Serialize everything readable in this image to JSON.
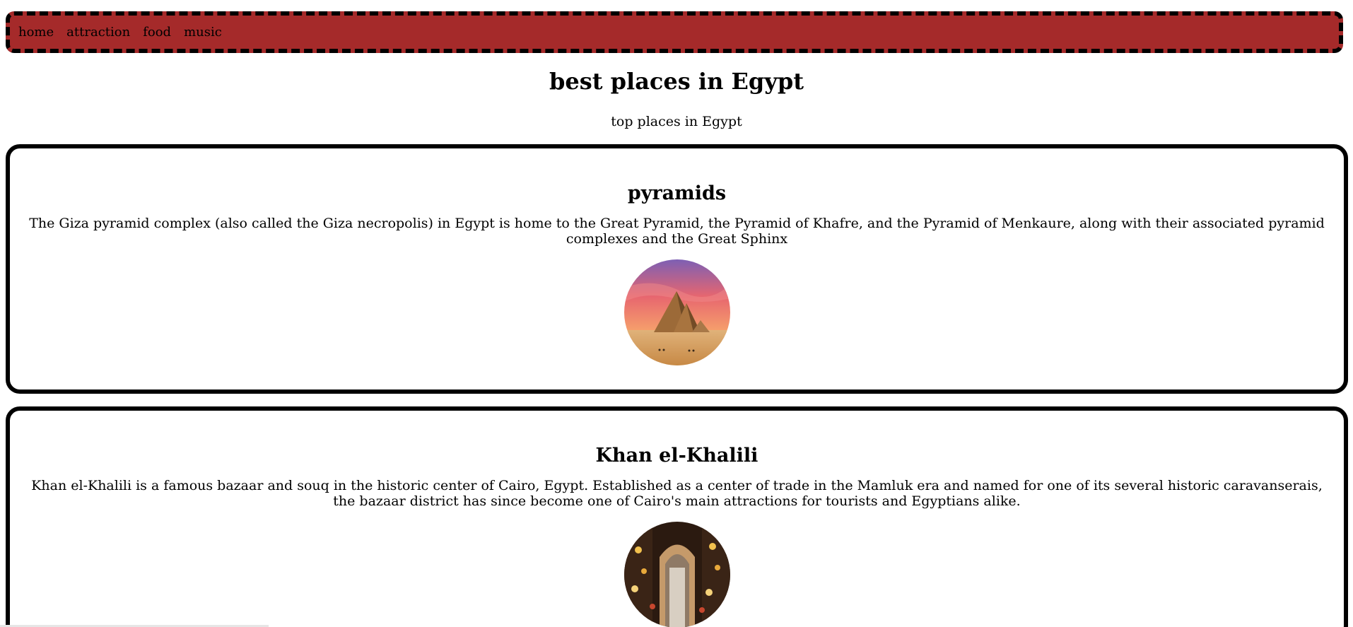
{
  "nav": {
    "items": [
      {
        "label": "home"
      },
      {
        "label": "attraction"
      },
      {
        "label": "food"
      },
      {
        "label": "music"
      }
    ]
  },
  "header": {
    "title": "best places in Egypt",
    "subtitle": "top places in Egypt"
  },
  "places": [
    {
      "title": "pyramids",
      "description": "The Giza pyramid complex (also called the Giza necropolis) in Egypt is home to the Great Pyramid, the Pyramid of Khafre, and the Pyramid of Menkaure, along with their associated pyramid complexes and the Great Sphinx",
      "image": "pyramids-photo"
    },
    {
      "title": "Khan el-Khalili",
      "description": "Khan el-Khalili is a famous bazaar and souq in the historic center of Cairo, Egypt. Established as a center of trade in the Mamluk era and named for one of its several historic caravanserais, the bazaar district has since become one of Cairo's main attractions for tourists and Egyptians alike.",
      "image": "bazaar-photo"
    }
  ],
  "colors": {
    "nav_background": "#a52a2a",
    "border": "#000000"
  }
}
